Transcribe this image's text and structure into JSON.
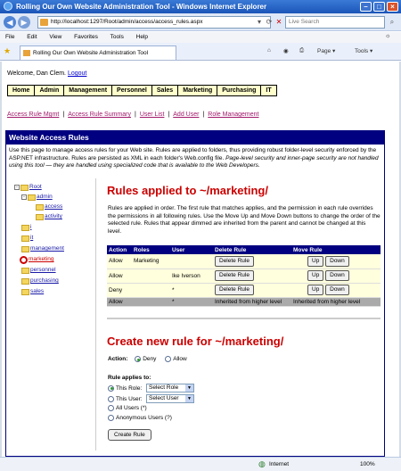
{
  "window": {
    "title": "Rolling Our Own Website Administration Tool - Windows Internet Explorer"
  },
  "browser": {
    "address": "http://localhost:1297/Root/admin/access/access_rules.aspx",
    "search_placeholder": "Live Search",
    "menu": [
      "File",
      "Edit",
      "View",
      "Favorites",
      "Tools",
      "Help"
    ],
    "tab_title": "Rolling Our Own Website Administration Tool",
    "page_menu": "Page ▾",
    "tools_menu": "Tools ▾"
  },
  "welcome": {
    "text": "Welcome, Dan Clem.",
    "logout": "Logout"
  },
  "main_nav": [
    "Home",
    "Admin",
    "Management",
    "Personnel",
    "Sales",
    "Marketing",
    "Purchasing",
    "IT"
  ],
  "sub_links": [
    "Access Rule Mgmt",
    "Access Rule Summary",
    "User List",
    "Add User",
    "Role Management"
  ],
  "panel": {
    "title": "Website Access Rules",
    "intro": "Use this page to manage access rules for your Web site. Rules are applied to folders, thus providing robust folder-level security enforced by the ASP.NET infrastructure. Rules are persisted as XML in each folder's Web.config file.",
    "intro_italic": "Page-level security and inner-page security are not handled using this tool — they are handled using specialized code that is available to the Web Developers."
  },
  "tree": [
    {
      "label": "Root",
      "pm": "-"
    },
    {
      "label": "admin",
      "pm": "-"
    },
    {
      "label": "access"
    },
    {
      "label": "activity"
    },
    {
      "label": "i"
    },
    {
      "label": "it"
    },
    {
      "label": "management"
    },
    {
      "label": "marketing",
      "selected": true
    },
    {
      "label": "personnel"
    },
    {
      "label": "purchasing"
    },
    {
      "label": "sales"
    }
  ],
  "rules": {
    "heading": "Rules applied to ~/marketing/",
    "description": "Rules are applied in order. The first rule that matches applies, and the permission in each rule overrides the permissions in all following rules. Use the Move Up and Move Down buttons to change the order of the selected rule. Rules that appear dimmed are inherited from the parent and cannot be changed at this level.",
    "columns": [
      "Action",
      "Roles",
      "User",
      "Delete Rule",
      "Move Rule"
    ],
    "rows": [
      {
        "action": "Allow",
        "roles": "Marketing",
        "user": ""
      },
      {
        "action": "Allow",
        "roles": "",
        "user": "Ike Iverson"
      },
      {
        "action": "Deny",
        "roles": "",
        "user": "*"
      }
    ],
    "inherited": {
      "action": "Allow",
      "roles": "",
      "user": "*",
      "delete": "Inherited from higher level",
      "move": "Inherited from higher level"
    },
    "delete_label": "Delete Rule",
    "up_label": "Up",
    "down_label": "Down"
  },
  "create": {
    "heading": "Create new rule for ~/marketing/",
    "action_label": "Action:",
    "deny": "Deny",
    "allow": "Allow",
    "applies_to": "Rule applies to:",
    "this_role": "This Role:",
    "role_select": "Select Role",
    "this_user": "This User:",
    "user_select": "Select User",
    "all_users": "All Users (*)",
    "anon_users": "Anonymous Users (?)",
    "button": "Create Rule"
  },
  "status": {
    "zone": "Internet",
    "zoom": "100%"
  }
}
